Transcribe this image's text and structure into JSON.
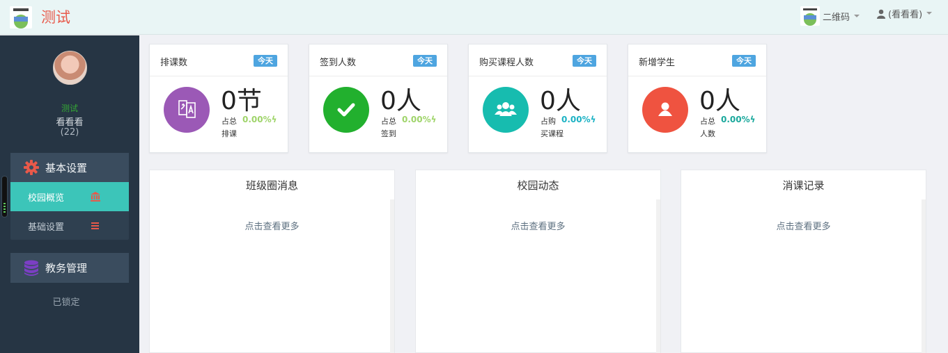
{
  "header": {
    "app_title": "测试",
    "qr_label": "二维码",
    "user_label": "(看看看)"
  },
  "sidebar": {
    "org_name": "测试",
    "user_name": "看看看",
    "user_count": "(22)",
    "groups": [
      {
        "label": "基本设置",
        "icon": "gear-icon",
        "items": [
          {
            "label": "校园概览",
            "icon": "bank-icon",
            "active": true
          },
          {
            "label": "基础设置",
            "icon": "list-icon",
            "active": false
          }
        ]
      },
      {
        "label": "教务管理",
        "icon": "database-icon",
        "locked_text": "已锁定"
      }
    ]
  },
  "stats": [
    {
      "title": "排课数",
      "badge": "今天",
      "value": "0节",
      "sub_prefix": "占总",
      "percent": "0.00%",
      "sub_line2": "排课",
      "icon": "translate-icon",
      "color": "#9b59b6",
      "pct_color": "#9fd46a"
    },
    {
      "title": "签到人数",
      "badge": "今天",
      "value": "0人",
      "sub_prefix": "占总",
      "percent": "0.00%",
      "sub_line2": "签到",
      "icon": "check-icon",
      "color": "#22b02e",
      "pct_color": "#9fd46a"
    },
    {
      "title": "购买课程人数",
      "badge": "今天",
      "value": "0人",
      "sub_prefix": "占购",
      "percent": "0.00%",
      "sub_line2": "买课程",
      "icon": "users-icon",
      "color": "#17bcaf",
      "pct_color": "#1bb2c4"
    },
    {
      "title": "新增学生",
      "badge": "今天",
      "value": "0人",
      "sub_prefix": "占总",
      "percent": "0.00%",
      "sub_line2": "人数",
      "icon": "user-icon",
      "color": "#ef5340",
      "pct_color": "#1aa89c"
    }
  ],
  "panels": [
    {
      "title": "班级圈消息",
      "more": "点击查看更多"
    },
    {
      "title": "校园动态",
      "more": "点击查看更多"
    },
    {
      "title": "消课记录",
      "more": "点击查看更多"
    }
  ]
}
